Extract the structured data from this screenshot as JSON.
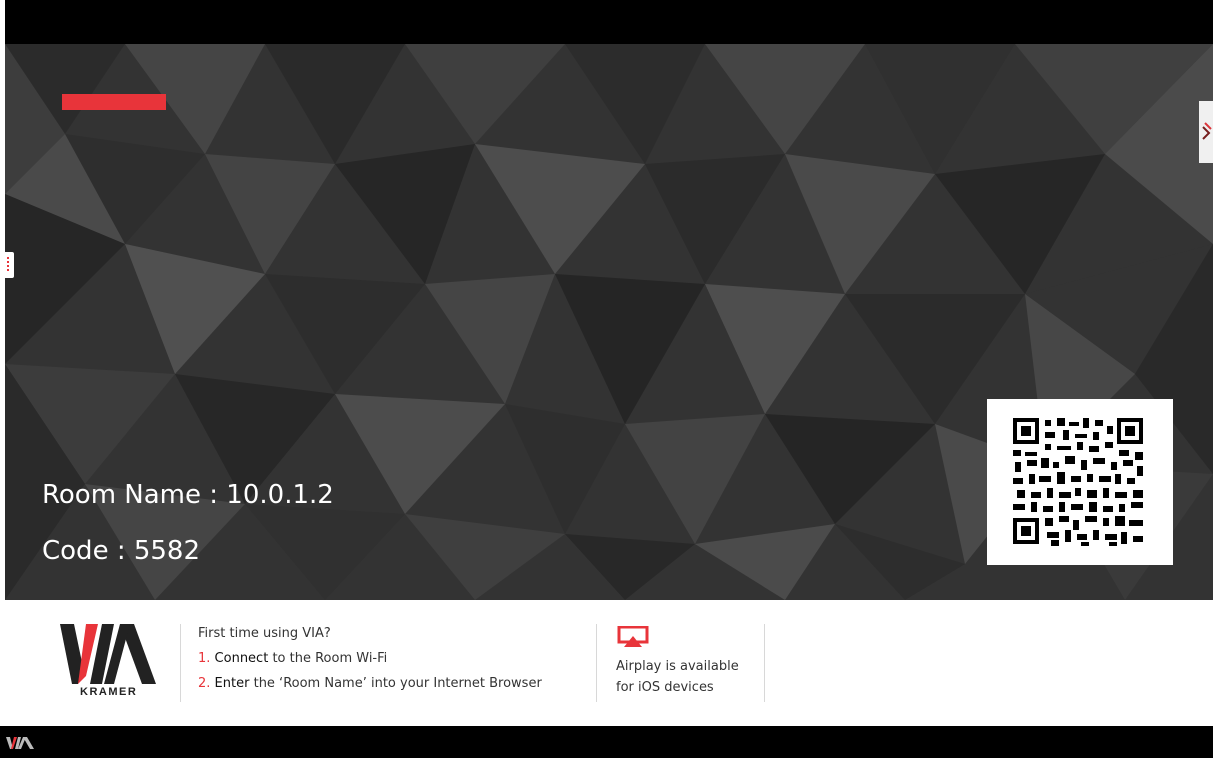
{
  "room": {
    "name_label": "Room Name : 10.0.1.2",
    "code_label": "Code : 5582"
  },
  "footer": {
    "logo_text": "VIA",
    "brand": "KRAMER",
    "intro": "First time using VIA?",
    "step1_num": "1.",
    "step1_bold": "Connect",
    "step1_rest": "to the Room Wi-Fi",
    "step2_num": "2.",
    "step2_bold": "Enter",
    "step2_rest": "the ‘Room Name’ into your Internet Browser",
    "airplay_line1": "Airplay is available",
    "airplay_line2": "for iOS devices"
  },
  "colors": {
    "accent": "#e8343a",
    "background_dark": "#2f2f2f",
    "text_light": "#ffffff"
  },
  "icons": {
    "qr": "qr-code-icon",
    "airplay": "airplay-icon",
    "side_menu": "vertical-dots-icon",
    "logo": "via-logo-icon"
  }
}
